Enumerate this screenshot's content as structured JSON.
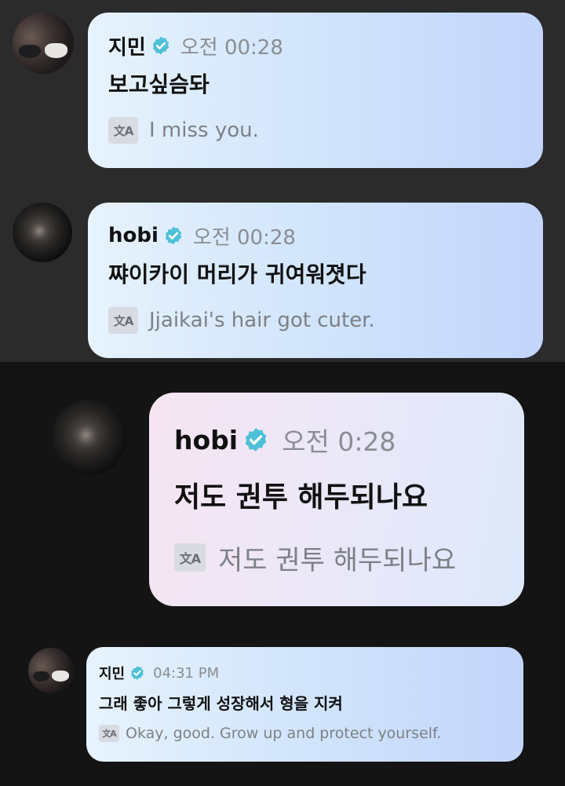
{
  "colors": {
    "verified_badge": "#4ec0d8",
    "name_text": "#111111",
    "time_text": "#8a8d93",
    "translation_text": "#7d8086"
  },
  "messages": [
    {
      "sender": "지민",
      "avatar": "jimin-avatar",
      "verified_icon": "verified-badge-icon",
      "time": "오전 00:28",
      "text": "보고싶슴돠",
      "translate_icon_label": "文A",
      "translation": "I miss you."
    },
    {
      "sender": "hobi",
      "avatar": "hobi-avatar",
      "verified_icon": "verified-badge-icon",
      "time": "오전 00:28",
      "text": "쨔이카이 머리가 귀여워졋다",
      "translate_icon_label": "文A",
      "translation": "Jjaikai's hair got cuter."
    },
    {
      "sender": "hobi",
      "avatar": "hobi-avatar",
      "verified_icon": "verified-badge-icon",
      "time": "오전 0:28",
      "text": "저도 권투 해두되나요",
      "translate_icon_label": "文A",
      "translation": "저도 권투 해두되나요"
    },
    {
      "sender": "지민",
      "avatar": "jimin-avatar",
      "verified_icon": "verified-badge-icon",
      "time": "04:31 PM",
      "text": "그래 좋아 그렇게 성장해서 형을 지켜",
      "translate_icon_label": "文A",
      "translation": "Okay, good. Grow up and protect yourself."
    }
  ]
}
